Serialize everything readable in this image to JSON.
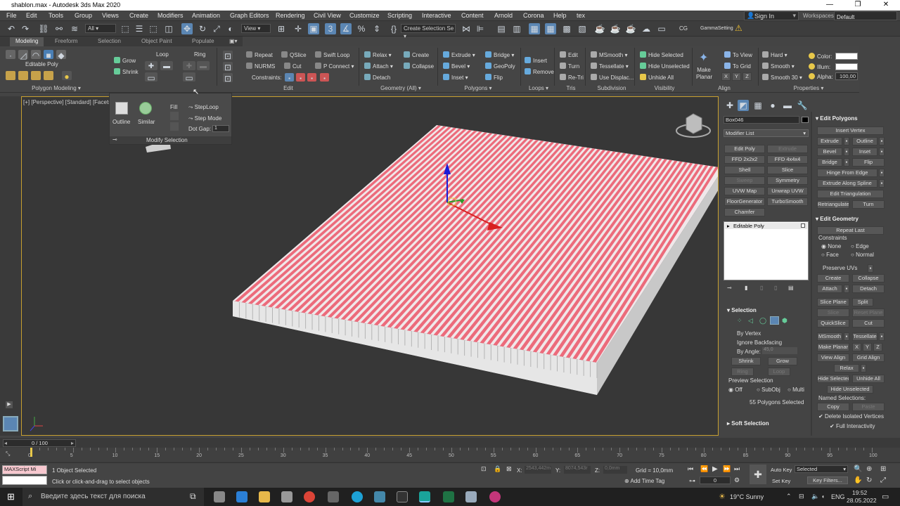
{
  "window": {
    "title": "shablon.max - Autodesk 3ds Max 2020"
  },
  "menu": [
    "File",
    "Edit",
    "Tools",
    "Group",
    "Views",
    "Create",
    "Modifiers",
    "Animation",
    "Graph Editors",
    "Rendering",
    "Civil View",
    "Customize",
    "Scripting",
    "Interactive",
    "Content",
    "Arnold",
    "Corona",
    "Help",
    "tex"
  ],
  "account": {
    "signin": "Sign In",
    "workspaces_label": "Workspaces:",
    "workspace": "Default"
  },
  "toolbar": {
    "filter": "All",
    "refcoord": "View",
    "selset": "Create Selection Se",
    "cg": "CG",
    "gamma": "GammaSetting"
  },
  "ribbon_tabs": [
    "Modeling",
    "Freeform",
    "Selection",
    "Object Paint",
    "Populate"
  ],
  "ribbon": {
    "editable_poly": "Editable Poly",
    "polygon_modeling": "Polygon Modeling ▾",
    "grow": "Grow",
    "shrink": "Shrink",
    "loop": "Loop",
    "ring": "Ring",
    "repeat": "Repeat",
    "nurms": "NURMS",
    "constraints": "Constraints:",
    "qslice": "QSlice",
    "cut": "Cut",
    "swift_loop": "Swift Loop",
    "p_connect": "P Connect",
    "edit_label": "Edit",
    "relax": "Relax",
    "attach": "Attach",
    "detach": "Detach",
    "create": "Create",
    "collapse": "Collapse",
    "geometry_label": "Geometry (All) ▾",
    "extrude": "Extrude",
    "bevel": "Bevel",
    "inset": "Inset",
    "bridge": "Bridge",
    "geopoly": "GeoPoly",
    "flip": "Flip",
    "polygons_label": "Polygons ▾",
    "insert": "Insert",
    "remove": "Remove",
    "loops_label": "Loops ▾",
    "r_edit": "Edit",
    "r_turn": "Turn",
    "r_retri": "Re-Tri",
    "tris_label": "Tris",
    "msmooth": "MSmooth",
    "tessellate": "Tessellate",
    "use_displac": "Use Displac...",
    "subdivision_label": "Subdivision",
    "hide_selected": "Hide Selected",
    "hide_unselected": "Hide Unselected",
    "unhide_all": "Unhide All",
    "visibility_label": "Visibility",
    "make_planar": "Make Planar",
    "to_view": "To View",
    "to_grid": "To Grid",
    "x": "X",
    "y": "Y",
    "z": "Z",
    "align_label": "Align",
    "hard": "Hard",
    "smooth": "Smooth",
    "smooth30": "Smooth 30",
    "color": "Color:",
    "illum": "Illum:",
    "alpha": "Alpha:",
    "alpha_val": "100,00",
    "properties_label": "Properties ▾"
  },
  "flyout": {
    "outline": "Outline",
    "similar": "Similar",
    "fill": "Fill",
    "steploop": "StepLoop",
    "stepmode": "Step Mode",
    "dotgap": "Dot Gap:",
    "dotgap_val": "1",
    "label": "Modify Selection"
  },
  "viewport": {
    "label": "[+] [Perspective] [Standard] [Facets"
  },
  "command_panel": {
    "object_name": "Box046",
    "modifier_list": "Modifier List",
    "mod_buttons": [
      "Edit Poly",
      "Extrude",
      "FFD 2x2x2",
      "FFD 4x4x4",
      "Shell",
      "Slice",
      "Sweep",
      "Symmetry",
      "UVW Map",
      "Unwrap UVW",
      "FloorGenerator",
      "TurboSmooth",
      "Chamfer"
    ],
    "stack_item": "Editable Poly",
    "selection_hdr": "Selection",
    "by_vertex": "By Vertex",
    "ignore_backfacing": "Ignore Backfacing",
    "by_angle": "By Angle:",
    "angle_val": "45,0",
    "shrink": "Shrink",
    "grow": "Grow",
    "ring": "Ring",
    "loop": "Loop",
    "preview_selection": "Preview Selection",
    "off": "Off",
    "subobj": "SubObj",
    "multi": "Multi",
    "selected_count": "55 Polygons Selected",
    "soft_selection": "Soft Selection",
    "edit_polygons_hdr": "Edit Polygons",
    "insert_vertex": "Insert Vertex",
    "ep_extrude": "Extrude",
    "ep_outline": "Outline",
    "ep_bevel": "Bevel",
    "ep_inset": "Inset",
    "ep_bridge": "Bridge",
    "ep_flip": "Flip",
    "hinge_from_edge": "Hinge From Edge",
    "extrude_along_spline": "Extrude Along Spline",
    "edit_triangulation": "Edit Triangulation",
    "retriangulate": "Retriangulate",
    "turn": "Turn",
    "edit_geometry_hdr": "Edit Geometry",
    "repeat_last": "Repeat Last",
    "constraints": "Constraints",
    "none": "None",
    "edge": "Edge",
    "face": "Face",
    "normal": "Normal",
    "preserve_uvs": "Preserve UVs",
    "create": "Create",
    "collapse": "Collapse",
    "attach": "Attach",
    "detach": "Detach",
    "slice_plane": "Slice Plane",
    "split": "Split",
    "slice": "Slice",
    "reset_plane": "Reset Plane",
    "quickslice": "QuickSlice",
    "cut": "Cut",
    "msmooth": "MSmooth",
    "tessellate": "Tessellate",
    "make_planar": "Make Planar",
    "x": "X",
    "y": "Y",
    "z": "Z",
    "view_align": "View Align",
    "grid_align": "Grid Align",
    "relax": "Relax",
    "hide_selected": "Hide Selected",
    "unhide_all": "Unhide All",
    "hide_unselected": "Hide Unselected",
    "named_selections": "Named Selections:",
    "copy": "Copy",
    "paste": "Paste",
    "delete_isolated": "Delete Isolated Vertices",
    "full_interactivity": "Full Interactivity"
  },
  "timeline": {
    "frame": "0 / 100",
    "ticks": [
      "0",
      "5",
      "10",
      "15",
      "20",
      "25",
      "30",
      "35",
      "40",
      "45",
      "50",
      "55",
      "60",
      "65",
      "70",
      "75",
      "80",
      "85",
      "90",
      "95",
      "100"
    ]
  },
  "status": {
    "maxscript": "MAXScript Mi",
    "objects_selected": "1 Object Selected",
    "prompt": "Click or click-and-drag to select objects",
    "x_label": "X:",
    "x_val": "2543,442m",
    "y_label": "Y:",
    "y_val": "8074,543r",
    "z_label": "Z:",
    "z_val": "0,0mm",
    "grid": "Grid = 10,0mm",
    "add_time_tag": "Add Time Tag",
    "auto_key": "Auto Key",
    "set_key": "Set Key",
    "selected": "Selected",
    "key_filters": "Key Filters...",
    "frame_val": "0"
  },
  "taskbar": {
    "search": "Введите здесь текст для поиска",
    "weather": "19°C  Sunny",
    "lang": "ENG",
    "time": "19:52",
    "date": "28.05.2022"
  },
  "colors": {
    "selection_red": "#ec6b7b",
    "active_blue": "#5b86b3",
    "viewport_border": "#c8a030"
  }
}
